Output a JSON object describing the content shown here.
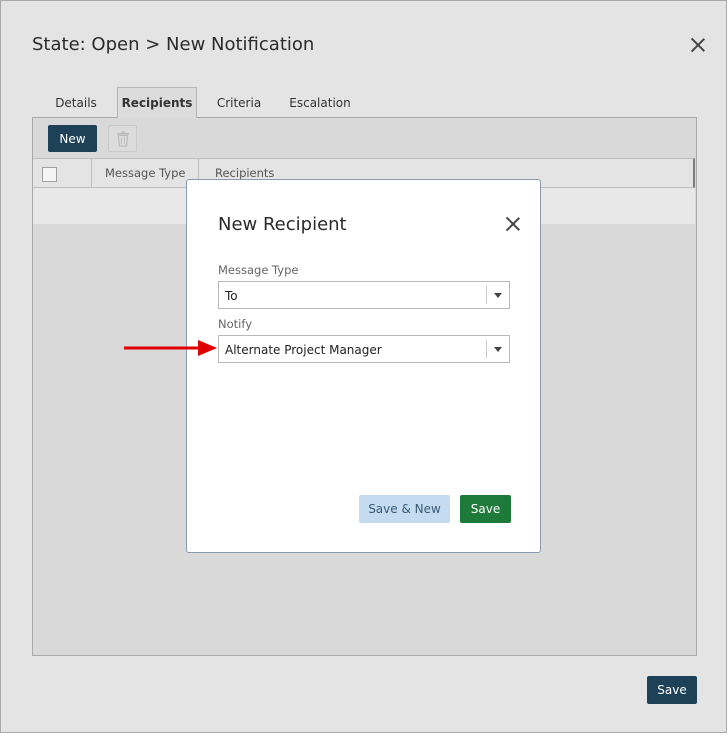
{
  "window": {
    "title": "State: Open > New Notification"
  },
  "tabs": [
    {
      "label": "Details",
      "active": false
    },
    {
      "label": "Recipients",
      "active": true
    },
    {
      "label": "Criteria",
      "active": false
    },
    {
      "label": "Escalation",
      "active": false
    }
  ],
  "toolbar": {
    "new_label": "New",
    "delete_icon": "trash-icon"
  },
  "grid": {
    "columns": [
      "Message Type",
      "Recipients"
    ]
  },
  "footer": {
    "save_label": "Save"
  },
  "modal": {
    "title": "New Recipient",
    "fields": [
      {
        "label": "Message Type",
        "value": "To"
      },
      {
        "label": "Notify",
        "value": "Alternate Project Manager"
      }
    ],
    "save_new_label": "Save & New",
    "save_label": "Save"
  },
  "colors": {
    "primary_button": "#1d4257",
    "save_green": "#1e7a38",
    "secondary_button": "#c5dcf0",
    "annotation_arrow": "#e00000"
  }
}
